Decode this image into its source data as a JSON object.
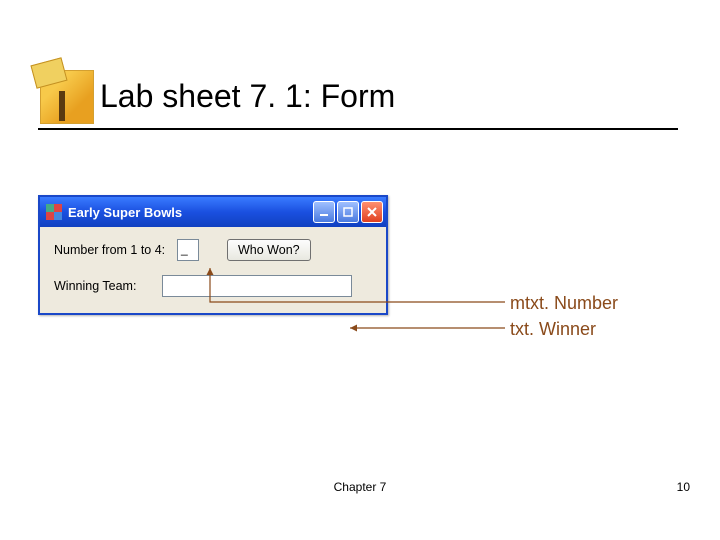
{
  "slide": {
    "title": "Lab sheet 7. 1: Form",
    "footer_center": "Chapter 7",
    "footer_right": "10"
  },
  "window": {
    "title": "Early Super Bowls",
    "label_number": "Number from 1 to 4:",
    "masked_value": "_",
    "button_whowon": "Who Won?",
    "label_winning": "Winning Team:",
    "txt_winner_value": ""
  },
  "annotations": {
    "mtxt": "mtxt. Number",
    "txtwinner": "txt. Winner"
  },
  "colors": {
    "annotation": "#8a4a1a",
    "titlebar": "#1a50e0"
  }
}
